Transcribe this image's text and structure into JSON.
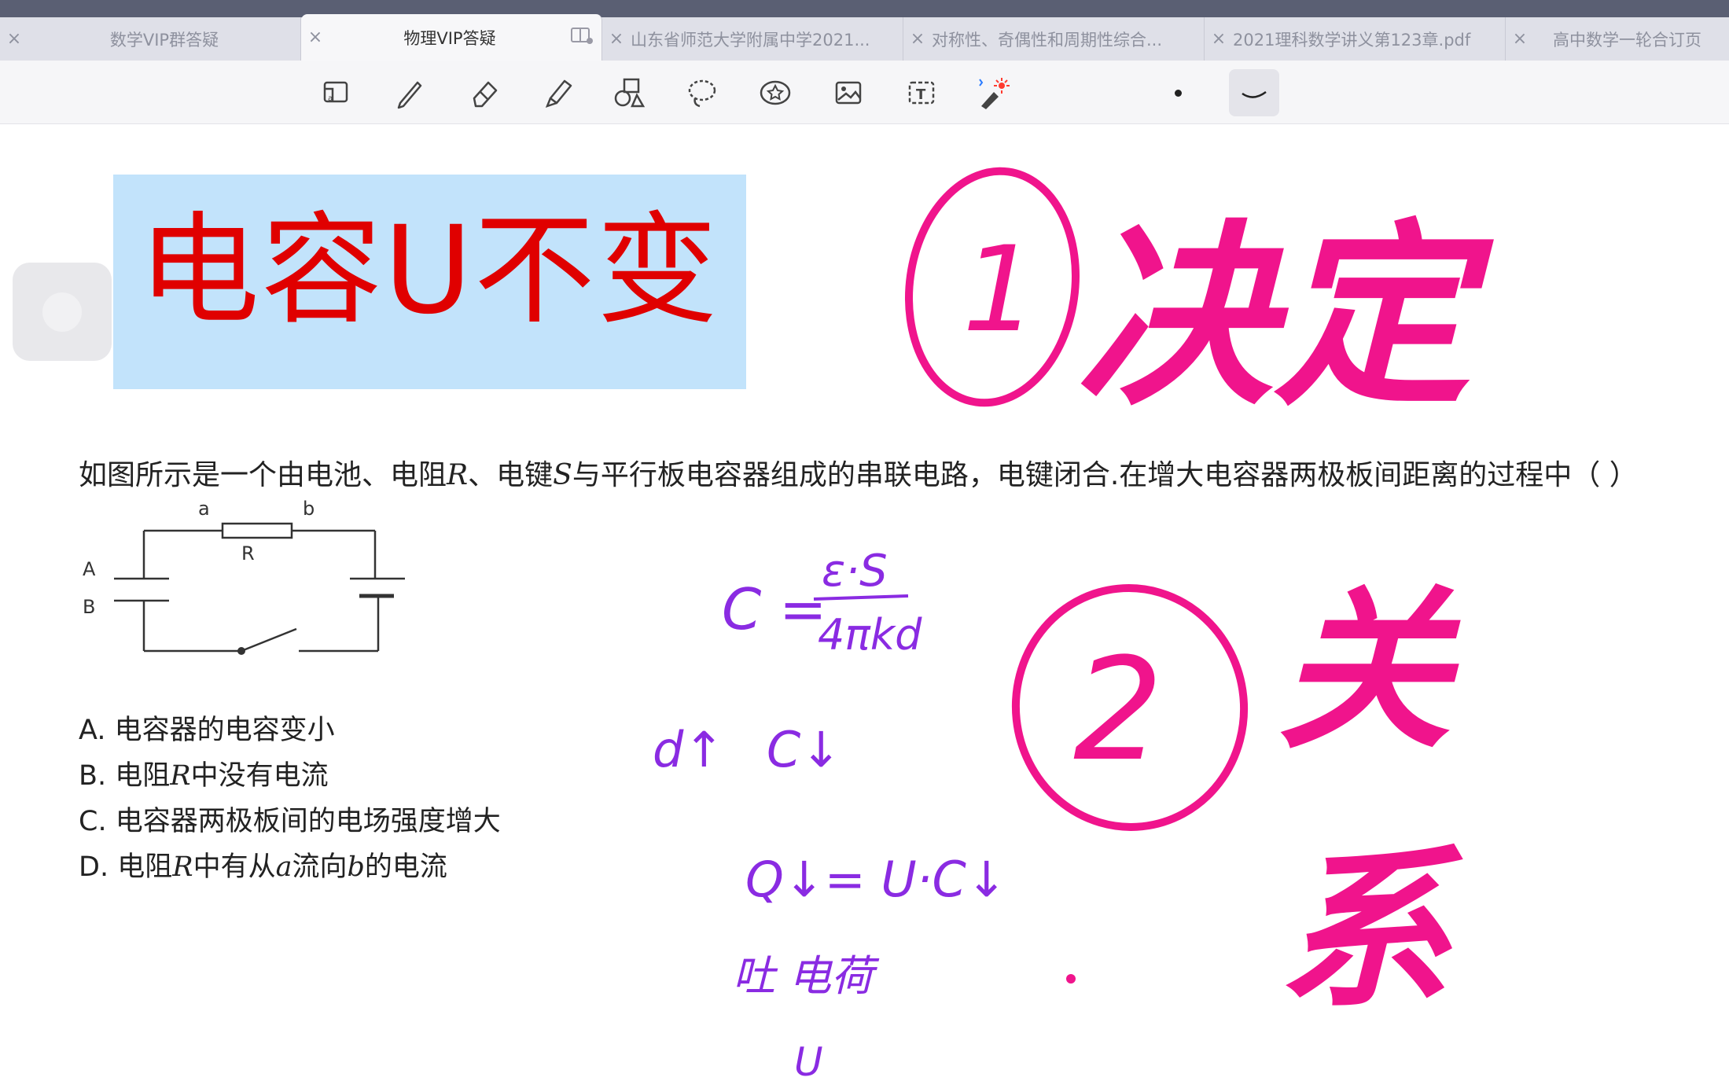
{
  "tabs": [
    {
      "label": "数学VIP群答疑",
      "close": "×"
    },
    {
      "label": "物理VIP答疑",
      "close": "×"
    },
    {
      "label": "山东省师范大学附属中学2021...",
      "close": "×"
    },
    {
      "label": "对称性、奇偶性和周期性综合...",
      "close": "×"
    },
    {
      "label": "2021理科数学讲义第123章.pdf",
      "close": "×"
    },
    {
      "label": "高中数学一轮合订页",
      "close": "×"
    }
  ],
  "toolbar": {
    "tools": [
      "page-view-icon",
      "pen-icon",
      "eraser-icon",
      "highlighter-icon",
      "shapes-icon",
      "lasso-icon",
      "sticker-icon",
      "image-icon",
      "text-icon",
      "laser-pointer-icon"
    ]
  },
  "banner": {
    "text": "电容U不变"
  },
  "question": {
    "text_before_R": "如图所示是一个由电池、电阻",
    "var_R": "R",
    "text_mid": "、电键",
    "var_S": "S",
    "text_after": "与平行板电容器组成的串联电路，电键闭合.在增大电容器两极板间距离的过程中（ ）"
  },
  "circuit": {
    "a": "a",
    "b": "b",
    "R": "R",
    "A": "A",
    "B": "B"
  },
  "options": [
    {
      "letter": "A.",
      "text": "电容器的电容变小"
    },
    {
      "letter": "B.",
      "pre": "电阻",
      "var": "R",
      "post": "中没有电流"
    },
    {
      "letter": "C.",
      "text": "电容器两极板间的电场强度增大"
    },
    {
      "letter": "D.",
      "pre": "电阻",
      "var": "R",
      "mid": "中有从",
      "var2": "a",
      "mid2": "流向",
      "var3": "b",
      "post": "的电流"
    }
  ],
  "annotations": {
    "circled1": "1",
    "word1": "决定",
    "circled2": "2",
    "word2": "关系",
    "formula_c": "C =",
    "formula_num": "ε·S",
    "formula_den": "4πkd",
    "line_d": "d↑",
    "line_c": "C↓",
    "line_q": "Q↓= U·C↓",
    "line_tu": "吐 电荷",
    "line_u": "U"
  },
  "colors": {
    "magenta": "#f0148c",
    "purple": "#8a2be2",
    "banner_bg": "#c2e3fb",
    "banner_text": "#e00000"
  }
}
